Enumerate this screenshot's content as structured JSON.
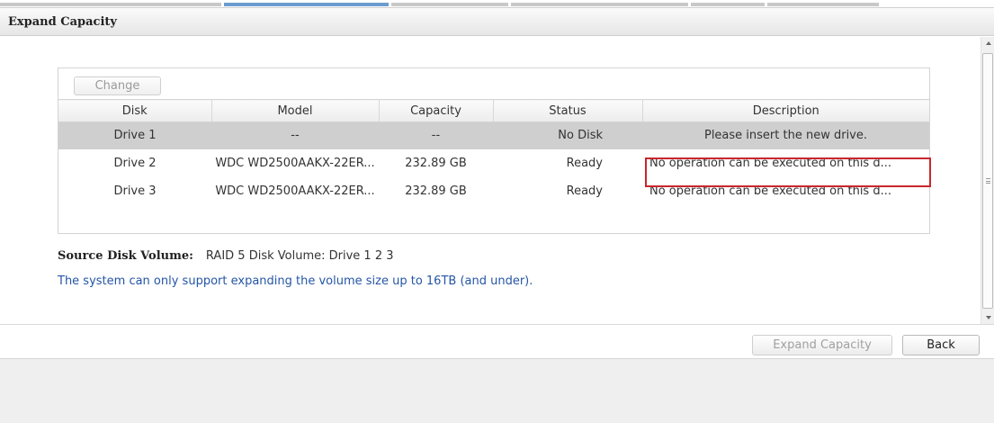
{
  "window": {
    "title": "Expand Capacity"
  },
  "grid": {
    "toolbar": {
      "change_label": "Change"
    },
    "columns": [
      "Disk",
      "Model",
      "Capacity",
      "Status",
      "Description"
    ],
    "rows": [
      {
        "disk": "Drive 1",
        "model": "--",
        "capacity": "--",
        "status": "No Disk",
        "description": "Please insert the new drive.",
        "selected": true
      },
      {
        "disk": "Drive 2",
        "model": "WDC WD2500AAKX-22ER...",
        "capacity": "232.89 GB",
        "status": "Ready",
        "description": "No operation can be executed on this d..."
      },
      {
        "disk": "Drive 3",
        "model": "WDC WD2500AAKX-22ER...",
        "capacity": "232.89 GB",
        "status": "Ready",
        "description": "No operation can be executed on this d..."
      }
    ]
  },
  "source": {
    "label": "Source Disk Volume:",
    "value": "RAID 5 Disk Volume: Drive 1 2 3"
  },
  "note": "The system can only support expanding the volume size up to 16TB (and under).",
  "footer": {
    "expand_label": "Expand Capacity",
    "back_label": "Back"
  },
  "colors": {
    "highlight": "#c9262c",
    "note_text": "#2456a6",
    "selected_row": "#cfcfcf"
  }
}
